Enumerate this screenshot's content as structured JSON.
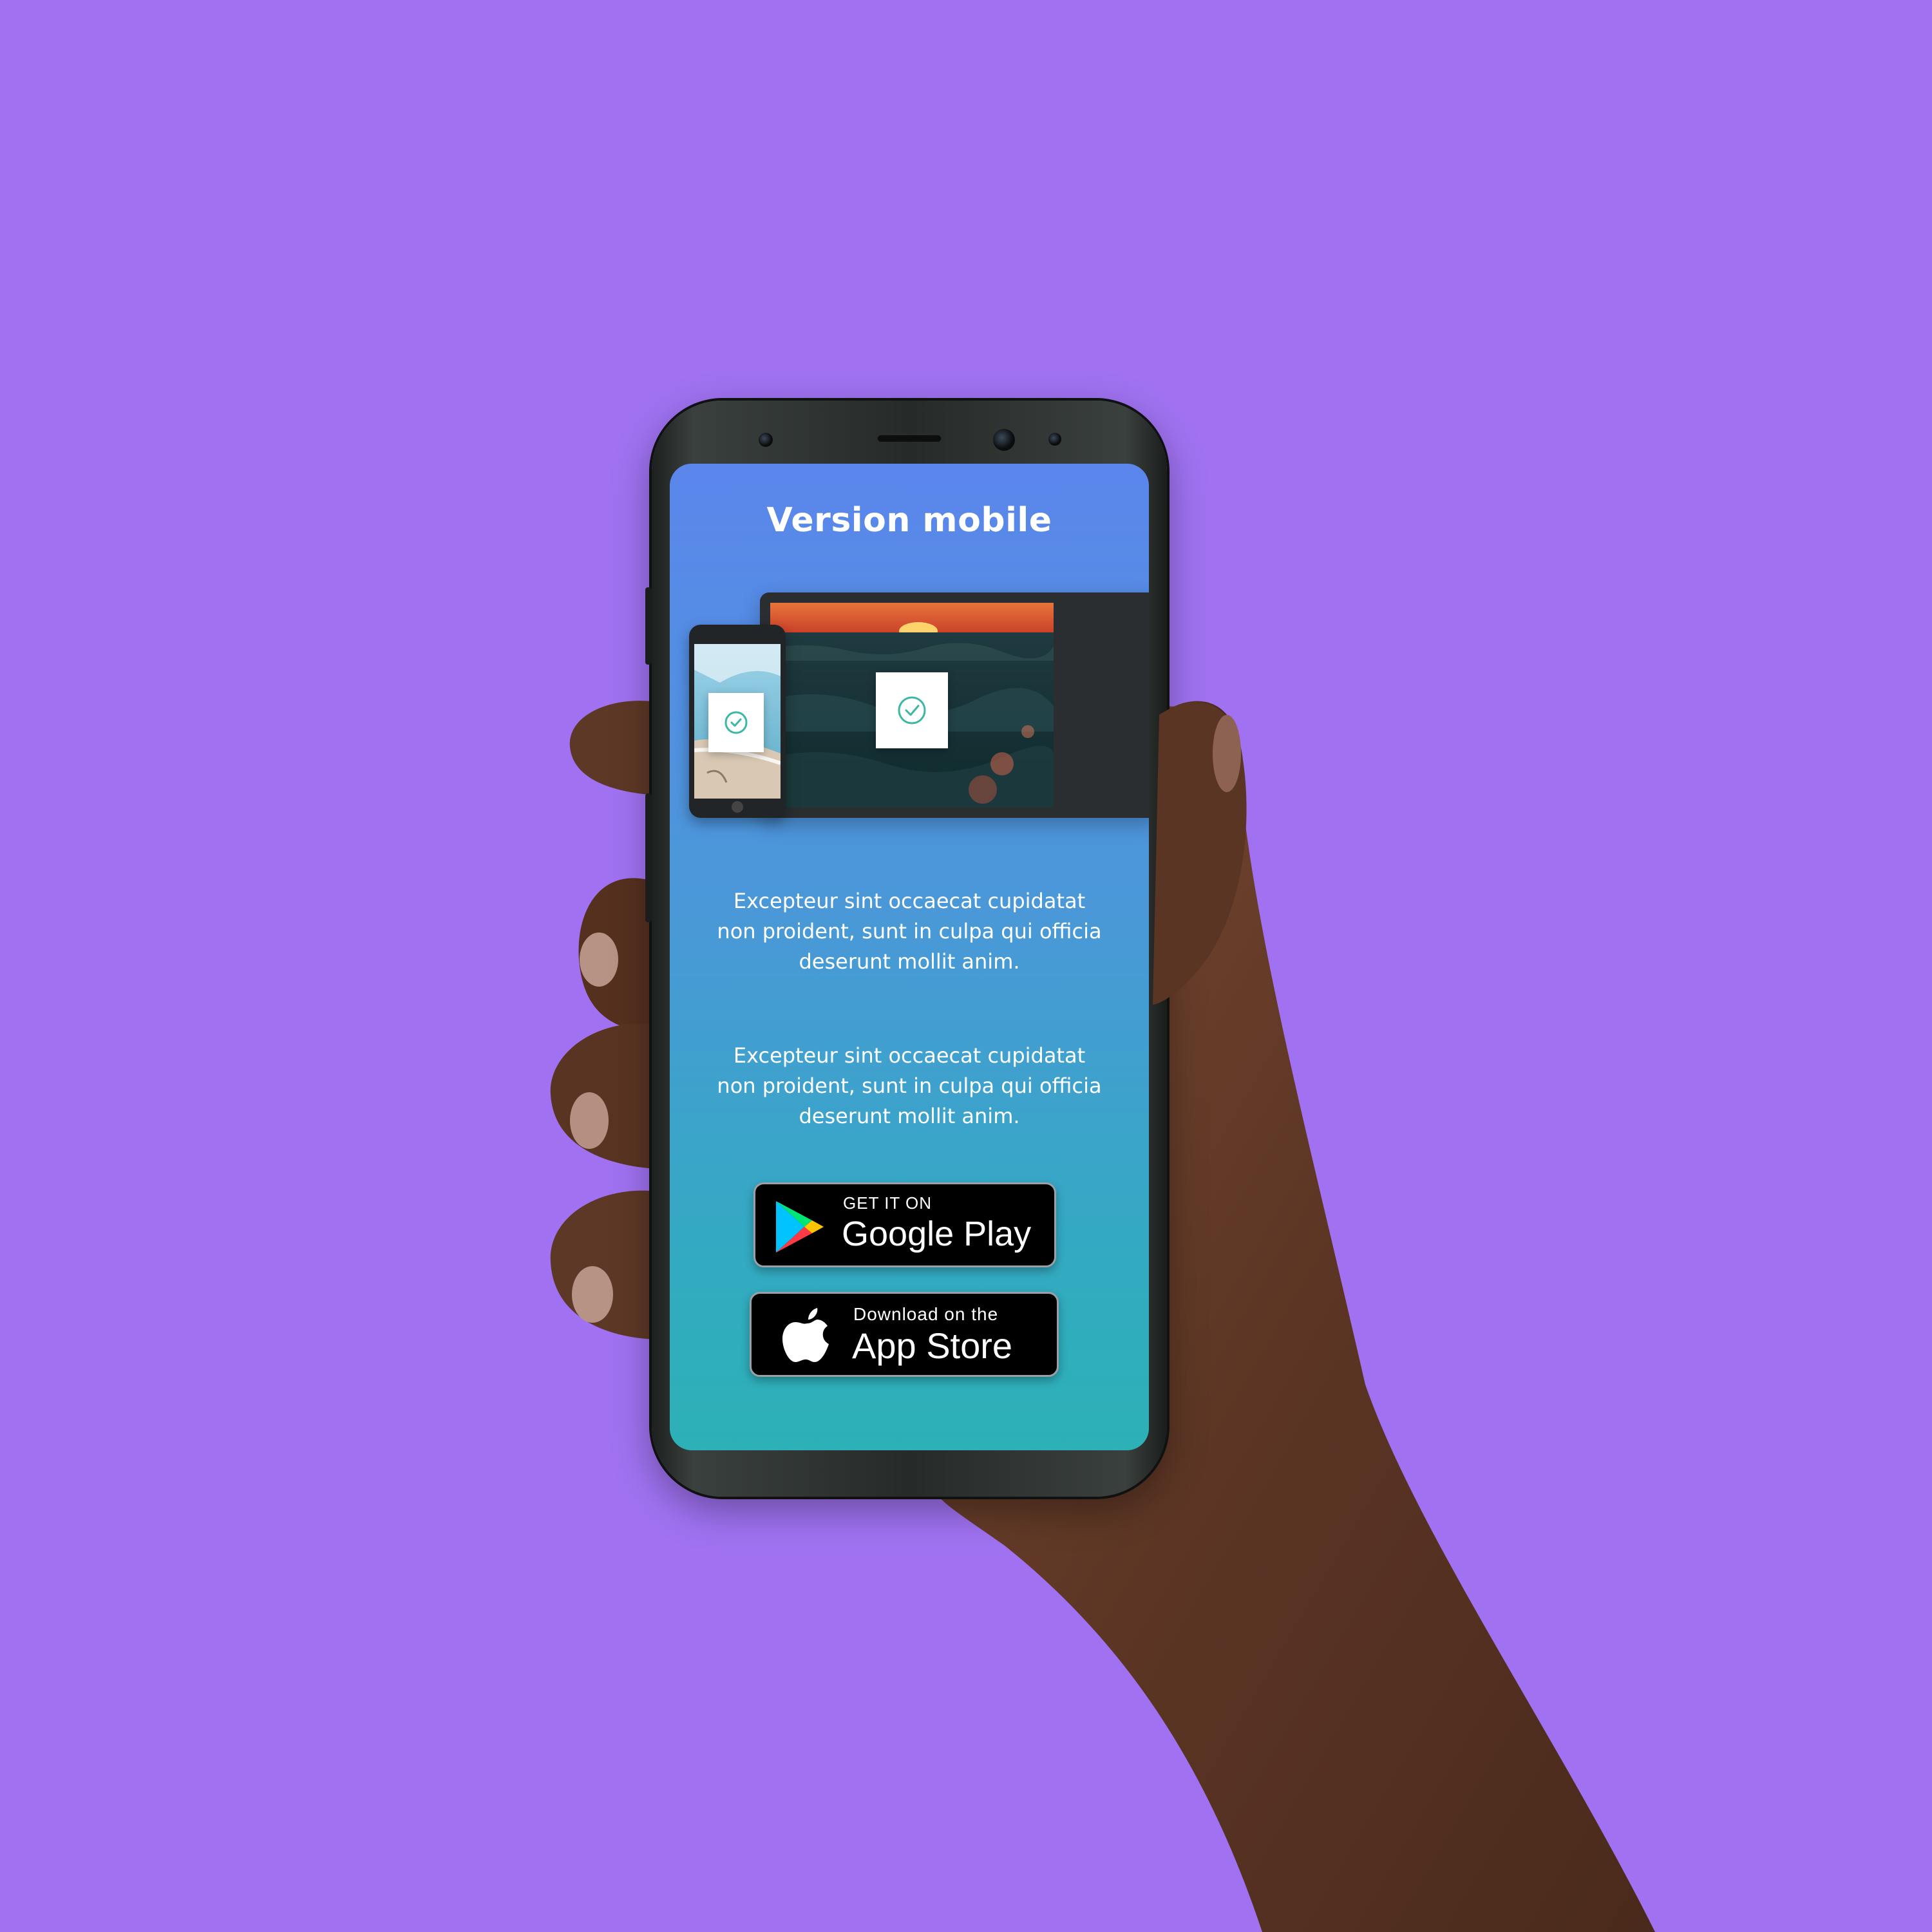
{
  "background_color": "#a072f2",
  "screen": {
    "title": "Version mobile",
    "paragraphs": [
      "Excepteur sint occaecat cupidatat non proident, sunt in culpa qui officia deserunt mollit anim.",
      "Excepteur sint occaecat cupidatat non proident, sunt in culpa qui officia deserunt mollit anim."
    ],
    "gradient": [
      "#5b86ec",
      "#2cb1b6"
    ]
  },
  "google_play": {
    "small_label": "GET IT ON",
    "big_label": "Google Play",
    "icon": "google-play-icon"
  },
  "app_store": {
    "small_label": "Download on the",
    "big_label": "App Store",
    "icon": "apple-icon"
  },
  "illustration": {
    "tablet_icon": "check-circle-icon",
    "phone_icon": "check-circle-icon"
  }
}
